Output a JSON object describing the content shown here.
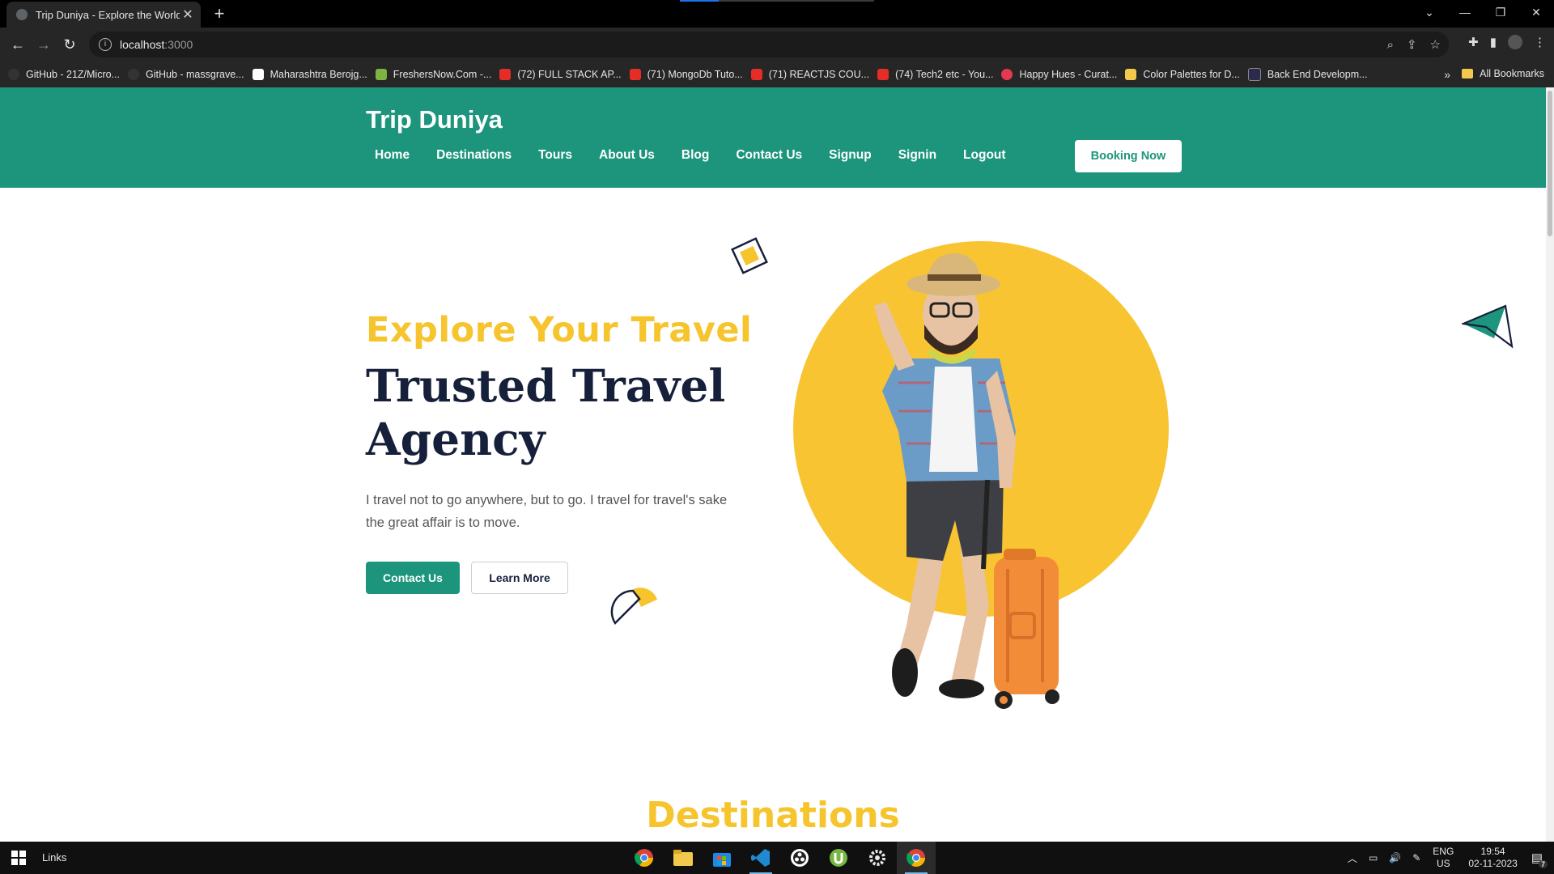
{
  "browser": {
    "tab_title": "Trip Duniya - Explore the World",
    "tab_close": "✕",
    "new_tab": "+",
    "window_controls": [
      "⌄",
      "—",
      "❐",
      "✕"
    ],
    "url_host": "localhost",
    "url_port": ":3000",
    "bookmarks": [
      {
        "label": "GitHub - 21Z/Micro...",
        "color": "#333333"
      },
      {
        "label": "GitHub - massgrave...",
        "color": "#333333"
      },
      {
        "label": "Maharashtra Berojg...",
        "color": "#ffffff"
      },
      {
        "label": "FreshersNow.Com -...",
        "color": "#7cb342"
      },
      {
        "label": "(72) FULL STACK AP...",
        "color": "#e52d27"
      },
      {
        "label": "(71) MongoDb Tuto...",
        "color": "#e52d27"
      },
      {
        "label": "(71) REACTJS COU...",
        "color": "#e52d27"
      },
      {
        "label": "(74) Tech2 etc - You...",
        "color": "#e52d27"
      },
      {
        "label": "Happy Hues - Curat...",
        "color": "#e53950"
      },
      {
        "label": "Color Palettes for D...",
        "color": "#f2c94c"
      },
      {
        "label": "Back End Developm...",
        "color": "#2a2a4a"
      }
    ],
    "bookmarks_more": "»",
    "all_bookmarks": "All Bookmarks"
  },
  "site": {
    "logo": "Trip Duniya",
    "nav": [
      "Home",
      "Destinations",
      "Tours",
      "About Us",
      "Blog",
      "Contact Us",
      "Signup",
      "Signin",
      "Logout"
    ],
    "booking_button": "Booking Now",
    "hero": {
      "subtitle": "Explore Your Travel",
      "title": "Trusted Travel Agency",
      "text": "I travel not to go anywhere, but to go. I travel for travel's sake the great affair is to move.",
      "contact_button": "Contact Us",
      "learn_button": "Learn More"
    },
    "section_title": "Destinations",
    "colors": {
      "primary": "#1c957c",
      "accent": "#f6c42c",
      "dark": "#17203b"
    }
  },
  "taskbar": {
    "links": "Links",
    "apps": [
      "chrome-icon",
      "file-explorer-icon",
      "store-icon",
      "vscode-icon",
      "obs-icon",
      "utorrent-icon",
      "settings-icon",
      "chrome-active-icon"
    ],
    "lang_top": "ENG",
    "lang_bottom": "US",
    "time": "19:54",
    "date": "02-11-2023",
    "notifications": "7"
  }
}
